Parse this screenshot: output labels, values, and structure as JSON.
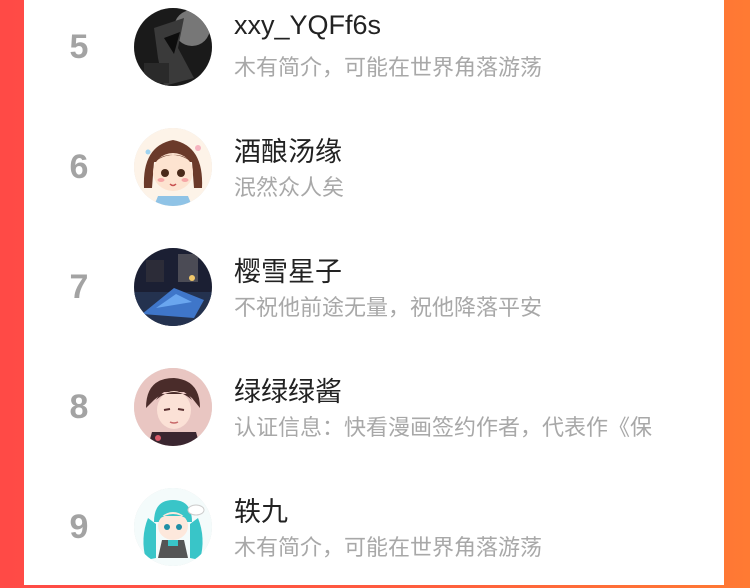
{
  "rankings": [
    {
      "rank": "5",
      "name": "xxy_YQFf6s",
      "bio": "木有简介，可能在世界角落游荡",
      "avatar_icon": "dark-figure-avatar"
    },
    {
      "rank": "6",
      "name": "酒酿汤缘",
      "bio": "泯然众人矣",
      "avatar_icon": "anime-girl-avatar"
    },
    {
      "rank": "7",
      "name": "樱雪星子",
      "bio": "不祝他前途无量，祝他降落平安",
      "avatar_icon": "night-scene-avatar"
    },
    {
      "rank": "8",
      "name": "绿绿绿酱",
      "bio": "认证信息：快看漫画签约作者，代表作《保",
      "avatar_icon": "anime-boy-avatar"
    },
    {
      "rank": "9",
      "name": "轶九",
      "bio": "木有简介，可能在世界角落游荡",
      "avatar_icon": "miku-chibi-avatar"
    }
  ],
  "colors": {
    "background_left": "#ff4a46",
    "background_right": "#ff7a33",
    "rank_color": "#a3a3a3",
    "name_color": "#222222",
    "bio_color": "#a8a8a8"
  }
}
